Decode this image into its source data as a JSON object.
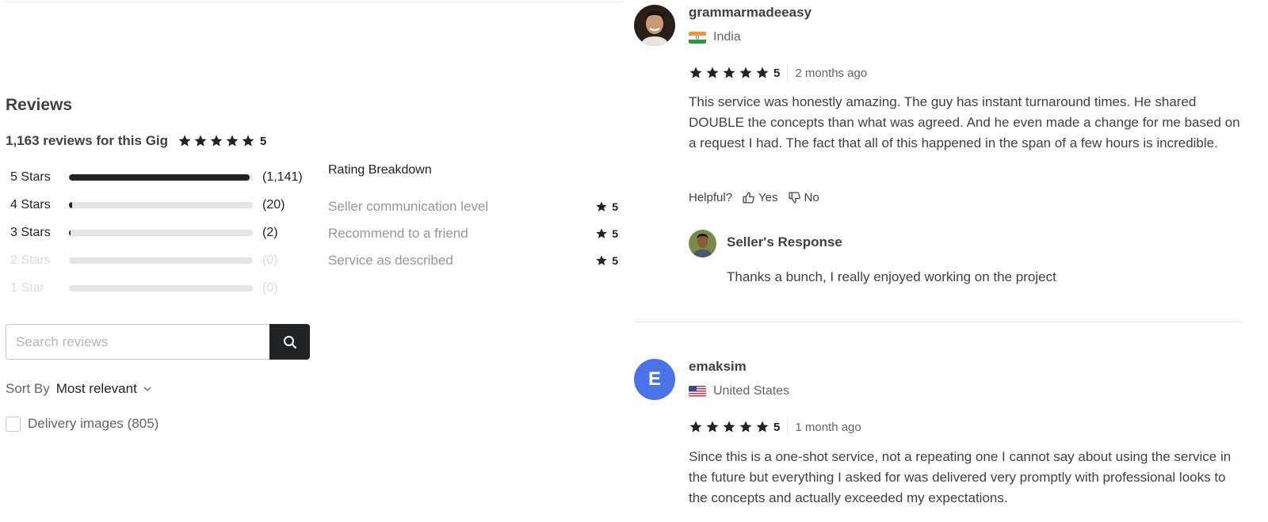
{
  "reviews_section": {
    "title": "Reviews",
    "summary_text": "1,163 reviews for this Gig",
    "overall_score": "5",
    "overall_stars": 5
  },
  "star_breakdown": [
    {
      "label": "5 Stars",
      "count": "(1,141)",
      "value": 1141,
      "empty": false
    },
    {
      "label": "4 Stars",
      "count": "(20)",
      "value": 20,
      "empty": false
    },
    {
      "label": "3 Stars",
      "count": "(2)",
      "value": 2,
      "empty": false
    },
    {
      "label": "2 Stars",
      "count": "(0)",
      "value": 0,
      "empty": true
    },
    {
      "label": "1 Star",
      "count": "(0)",
      "value": 0,
      "empty": true
    }
  ],
  "star_breakdown_total": 1163,
  "rating_breakdown": {
    "title": "Rating Breakdown",
    "items": [
      {
        "label": "Seller communication level",
        "score": "5"
      },
      {
        "label": "Recommend to a friend",
        "score": "5"
      },
      {
        "label": "Service as described",
        "score": "5"
      }
    ]
  },
  "search": {
    "placeholder": "Search reviews",
    "value": ""
  },
  "sort": {
    "label": "Sort By",
    "value": "Most relevant"
  },
  "filter": {
    "delivery_images_label": "Delivery images (805)",
    "checked": false
  },
  "reviews": [
    {
      "username": "grammarmadeeasy",
      "country": "India",
      "flag": "india",
      "avatar_type": "photo",
      "stars": 5,
      "score": "5",
      "time": "2 months ago",
      "text": "This service was honestly amazing. The guy has instant turnaround times. He shared DOUBLE the concepts than what was agreed. And he even made a change for me based on a request I had. The fact that all of this happened in the span of a few hours is incredible.",
      "helpful_label": "Helpful?",
      "yes_label": "Yes",
      "no_label": "No",
      "seller_response_title": "Seller's Response",
      "seller_response_text": "Thanks a bunch, I really enjoyed working on the project"
    },
    {
      "username": "emaksim",
      "country": "United States",
      "flag": "usa",
      "avatar_type": "letter",
      "avatar_letter": "E",
      "avatar_color": "#4a73e8",
      "stars": 5,
      "score": "5",
      "time": "1 month ago",
      "text": "Since this is a one-shot service, not a repeating one I cannot say about using the service in the future but everything I asked for was delivered very promptly with professional looks to the concepts and actually exceeded my expectations."
    }
  ],
  "colors": {
    "star": "#222325",
    "bar_fill": "#222325",
    "bar_track": "#e4e5e7",
    "search_button": "#222325"
  }
}
